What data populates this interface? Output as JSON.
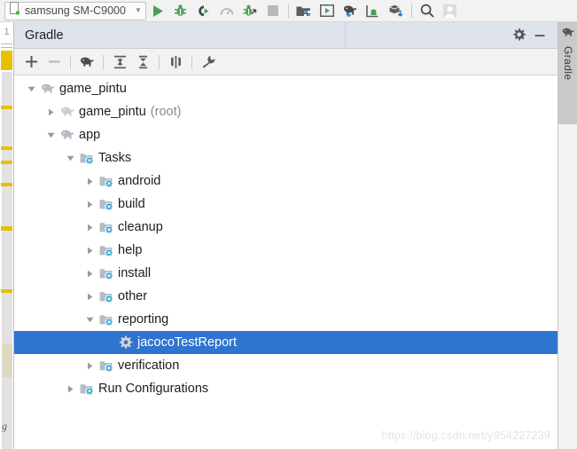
{
  "toolbar": {
    "device": {
      "icon": "phone-icon",
      "label": "samsung SM-C9000",
      "arrow": "▼"
    },
    "buttons": [
      {
        "name": "run-button",
        "icon": "run-triangle-icon",
        "label": "Run"
      },
      {
        "name": "debug-button",
        "icon": "bug-icon",
        "label": "Debug"
      },
      {
        "name": "attach-debugger-button",
        "icon": "attach-debugger-icon",
        "label": "Attach debugger to Android process"
      },
      {
        "name": "profiler-button",
        "icon": "profiler-gauge-icon",
        "label": "Profile"
      },
      {
        "name": "run-coverage-button",
        "icon": "bug-arrow-icon",
        "label": "Run with coverage"
      },
      {
        "name": "stop-button",
        "icon": "stop-square-icon",
        "label": "Stop"
      },
      {
        "name": "sdk-manager-button",
        "icon": "sdk-manager-icon",
        "label": "SDK Manager"
      },
      {
        "name": "avd-manager-button",
        "icon": "avd-manager-icon",
        "label": "AVD Manager"
      },
      {
        "name": "sync-gradle-button",
        "icon": "elephant-sync-icon",
        "label": "Sync Project with Gradle Files"
      },
      {
        "name": "device-monitor-button",
        "icon": "android-monitor-icon",
        "label": "Android Device Monitor"
      },
      {
        "name": "project-structure-button",
        "icon": "package-download-icon",
        "label": "Project Structure"
      },
      {
        "name": "search-everywhere-button",
        "icon": "search-icon",
        "label": "Search Everywhere"
      },
      {
        "name": "account-button",
        "icon": "user-avatar-icon",
        "label": "Account"
      }
    ]
  },
  "left_strip": {
    "line_number": "1",
    "fold_glyph": "g"
  },
  "panel": {
    "title": "Gradle",
    "header_buttons": [
      {
        "name": "settings-button",
        "icon": "gear-icon",
        "label": "Settings"
      },
      {
        "name": "hide-button",
        "icon": "minimize-icon",
        "label": "Hide"
      }
    ],
    "toolbar_buttons": [
      {
        "name": "add-task-button",
        "icon": "plus-icon",
        "label": "Link Gradle Project"
      },
      {
        "name": "remove-task-button",
        "icon": "minus-icon",
        "label": "Unlink Gradle Project"
      },
      {
        "name": "refresh-gradle-button",
        "icon": "elephant-icon",
        "label": "Refresh all Gradle projects"
      },
      {
        "name": "expand-all-button",
        "icon": "expand-all-icon",
        "label": "Expand All"
      },
      {
        "name": "collapse-all-button",
        "icon": "collapse-all-icon",
        "label": "Collapse All"
      },
      {
        "name": "toggle-offline-button",
        "icon": "toggle-offline-icon",
        "label": "Toggle Offline Mode"
      },
      {
        "name": "execute-task-button",
        "icon": "wrench-icon",
        "label": "Execute Gradle Task"
      }
    ]
  },
  "tree": {
    "nodes": [
      {
        "label": "game_pintu",
        "suffix": "",
        "icon": "elephant-icon",
        "twisty": "expanded",
        "depth": 0,
        "selected": false
      },
      {
        "label": "game_pintu",
        "suffix": "(root)",
        "icon": "elephant-icon",
        "twisty": "collapsed",
        "depth": 1,
        "selected": false
      },
      {
        "label": "app",
        "suffix": "",
        "icon": "elephant-icon",
        "twisty": "expanded",
        "depth": 1,
        "selected": false
      },
      {
        "label": "Tasks",
        "suffix": "",
        "icon": "folder-gear-icon",
        "twisty": "expanded",
        "depth": 2,
        "selected": false
      },
      {
        "label": "android",
        "suffix": "",
        "icon": "folder-gear-icon",
        "twisty": "collapsed",
        "depth": 3,
        "selected": false
      },
      {
        "label": "build",
        "suffix": "",
        "icon": "folder-gear-icon",
        "twisty": "collapsed",
        "depth": 3,
        "selected": false
      },
      {
        "label": "cleanup",
        "suffix": "",
        "icon": "folder-gear-icon",
        "twisty": "collapsed",
        "depth": 3,
        "selected": false
      },
      {
        "label": "help",
        "suffix": "",
        "icon": "folder-gear-icon",
        "twisty": "collapsed",
        "depth": 3,
        "selected": false
      },
      {
        "label": "install",
        "suffix": "",
        "icon": "folder-gear-icon",
        "twisty": "collapsed",
        "depth": 3,
        "selected": false
      },
      {
        "label": "other",
        "suffix": "",
        "icon": "folder-gear-icon",
        "twisty": "collapsed",
        "depth": 3,
        "selected": false
      },
      {
        "label": "reporting",
        "suffix": "",
        "icon": "folder-gear-icon",
        "twisty": "expanded",
        "depth": 3,
        "selected": false
      },
      {
        "label": "jacocoTestReport",
        "suffix": "",
        "icon": "gear-icon",
        "twisty": "none",
        "depth": 4,
        "selected": true
      },
      {
        "label": "verification",
        "suffix": "",
        "icon": "folder-gear-icon",
        "twisty": "collapsed",
        "depth": 3,
        "selected": false
      },
      {
        "label": "Run Configurations",
        "suffix": "",
        "icon": "folder-gear-icon",
        "twisty": "collapsed",
        "depth": 2,
        "selected": false
      }
    ]
  },
  "watermark": "https://blog.csdn.net/y954227239",
  "right_sidebar": {
    "tab": {
      "label": "Gradle",
      "icon": "elephant-icon"
    }
  },
  "colors": {
    "selection_blue": "#2f74d0",
    "panel_header": "#dfe3ec",
    "toolbar_bg": "#f2f2f2",
    "accent_green": "#4d9e55",
    "icon_blue": "#2f9fd4",
    "marker_yellow": "#e8c000"
  }
}
